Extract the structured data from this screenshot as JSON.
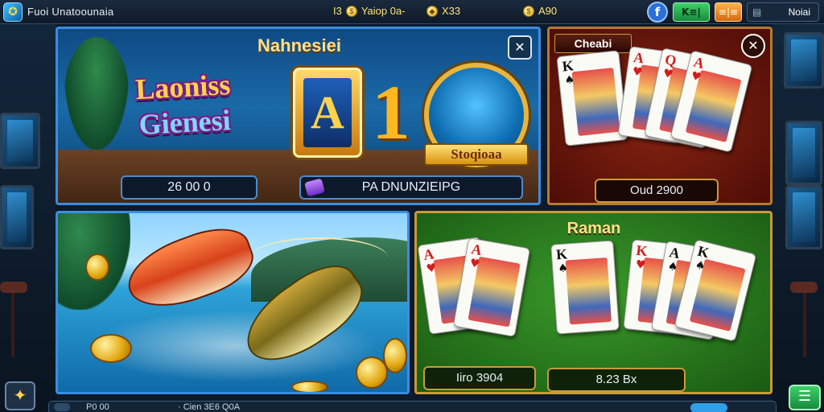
{
  "header": {
    "logo_glyph": "✪",
    "app_title": "Fuoi Unatoounaia",
    "stat1_label": "Yaiop 0a-",
    "stat1_prefix": "I3",
    "stat2_label": "X33",
    "stat3_label": "A90",
    "facebook_glyph": "f",
    "green_button_label": "K≡|",
    "orange_button_label": "≡|≡",
    "menu_glyph": "▤",
    "menu_label": "Noiai"
  },
  "panels": {
    "top_left": {
      "title": "Nahnesiei",
      "logo_line1": "Laoniss",
      "logo_line2": "Gienesi",
      "tile_letter": "A",
      "tile_number": "1",
      "medal_label": "Stoqioaa",
      "amount": "26 00 0",
      "promo_label": "PA DNUNZIEIPG",
      "close_glyph": "✕"
    },
    "top_right": {
      "title": "Cheabi",
      "amount": "Oud 2900",
      "close_glyph": "✕"
    },
    "bottom_left": {
      "name": "fishing-game"
    },
    "bottom_right": {
      "title": "Raman",
      "amount_a": "Iiro 3904",
      "amount_b": "8.23 Bx"
    }
  },
  "cards_top_right": [
    {
      "rank": "K",
      "suit": "♠",
      "color": "blk"
    },
    {
      "rank": "A",
      "suit": "♥",
      "color": "red"
    },
    {
      "rank": "Q",
      "suit": "♥",
      "color": "red"
    },
    {
      "rank": "A",
      "suit": "♥",
      "color": "red"
    }
  ],
  "cards_bottom_right": [
    {
      "rank": "A",
      "suit": "♥",
      "color": "red"
    },
    {
      "rank": "A",
      "suit": "♥",
      "color": "red"
    },
    {
      "rank": "K",
      "suit": "♠",
      "color": "blk"
    },
    {
      "rank": "K",
      "suit": "♥",
      "color": "red"
    },
    {
      "rank": "A",
      "suit": "♠",
      "color": "blk"
    },
    {
      "rank": "K",
      "suit": "♠",
      "color": "blk"
    }
  ],
  "footer": {
    "text1": "P0 00",
    "text2": "· Cien 3E6 Q0A",
    "star_glyph": "✦",
    "plus_glyph": "☰"
  },
  "colors": {
    "accent_gold": "#c99a3a",
    "accent_blue": "#3a8ee0",
    "felt_green": "#2a7a1e",
    "felt_red": "#7a1a0c"
  }
}
